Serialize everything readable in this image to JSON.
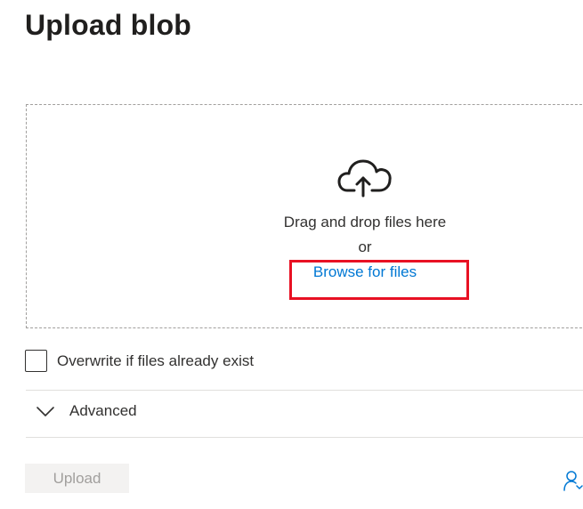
{
  "panel": {
    "title": "Upload blob"
  },
  "dropzone": {
    "icon": "cloud-upload-icon",
    "drag_text": "Drag and drop files here",
    "or_text": "or",
    "browse_label": "Browse for files",
    "highlight_color": "#e81123"
  },
  "options": {
    "overwrite_label": "Overwrite if files already exist",
    "overwrite_checked": false,
    "advanced_label": "Advanced",
    "advanced_icon": "chevron-down-icon"
  },
  "footer": {
    "upload_label": "Upload",
    "feedback_icon": "feedback-person-icon"
  },
  "colors": {
    "link": "#0078d4",
    "disabled_text": "#a19f9d",
    "disabled_bg": "#f3f2f1"
  }
}
